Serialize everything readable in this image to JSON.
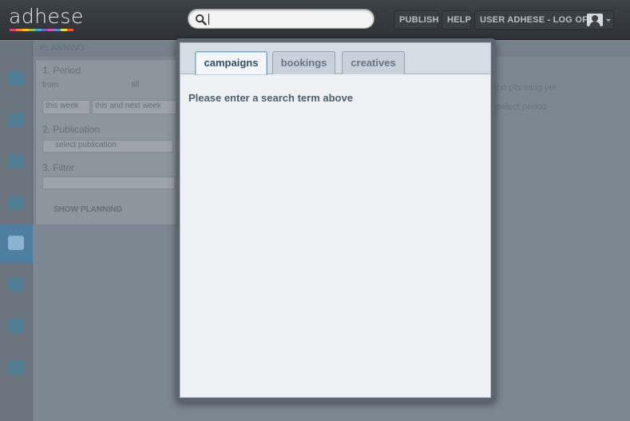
{
  "app": {
    "logo_text": "adhese",
    "logo_colors": [
      "#e23a6b",
      "#f08a2c",
      "#f5c22c",
      "#8bc34a",
      "#3fa9c9",
      "#7d5bbf",
      "#d94fa0",
      "#4a90d9",
      "#e8e03a",
      "#f05a3a"
    ]
  },
  "header": {
    "search": {
      "value": "",
      "placeholder": ""
    },
    "publish_label": "PUBLISH",
    "help_label": "HELP",
    "user_label": "USER ADHESE - LOG OFF"
  },
  "background": {
    "crumb": "PLANNING",
    "section1": "1. Period",
    "from_label": "from",
    "till_label": "till",
    "this_week": "this week",
    "this_next": "this and next week",
    "section2": "2. Publication",
    "publication_select": "select publication",
    "section3": "3. Filter",
    "show_button": "SHOW PLANNING",
    "right_text_1": "no planning yet",
    "right_text_2": "select period"
  },
  "search_panel": {
    "tabs": [
      {
        "label": "campaigns",
        "active": true
      },
      {
        "label": "bookings",
        "active": false
      },
      {
        "label": "creatives",
        "active": false
      }
    ],
    "empty_message": "Please enter a search term above"
  }
}
